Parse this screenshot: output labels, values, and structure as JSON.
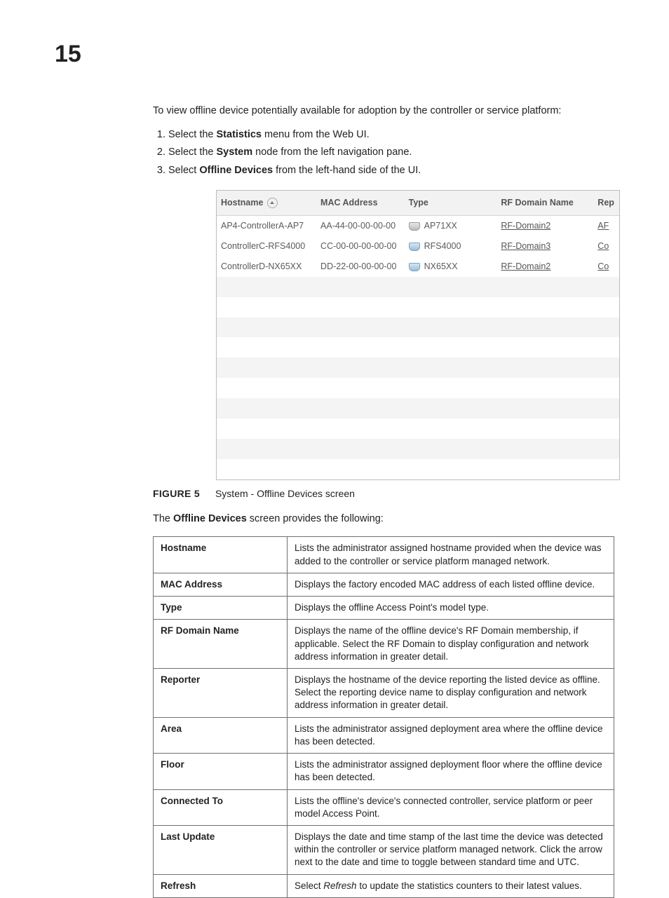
{
  "chapter_number": "15",
  "intro": "To view offline device potentially available for adoption by the controller or service platform:",
  "steps": [
    {
      "pre": "Select the ",
      "bold": "Statistics",
      "post": " menu from the Web UI."
    },
    {
      "pre": "Select the ",
      "bold": "System",
      "post": " node from the left navigation pane."
    },
    {
      "pre": "Select ",
      "bold": "Offline Devices",
      "post": " from the left-hand side of the UI."
    }
  ],
  "screenshot": {
    "columns": {
      "hostname": "Hostname",
      "mac": "MAC Address",
      "type": "Type",
      "rf": "RF Domain Name",
      "rep": "Rep"
    },
    "rows": [
      {
        "hostname": "AP4-ControllerA-AP7",
        "mac": "AA-44-00-00-00-00",
        "icon": "ap",
        "type": "AP71XX",
        "rf": "RF-Domain2",
        "rep": "AF"
      },
      {
        "hostname": "ControllerC-RFS4000",
        "mac": "CC-00-00-00-00-00",
        "icon": "ct",
        "type": "RFS4000",
        "rf": "RF-Domain3",
        "rep": "Co"
      },
      {
        "hostname": "ControllerD-NX65XX",
        "mac": "DD-22-00-00-00-00",
        "icon": "ct",
        "type": "NX65XX",
        "rf": "RF-Domain2",
        "rep": "Co"
      }
    ],
    "empty_rows": 10
  },
  "figure": {
    "label": "FIGURE 5",
    "caption": "System - Offline Devices screen"
  },
  "after_fig": {
    "pre": "The ",
    "bold": "Offline Devices",
    "post": " screen provides the following:"
  },
  "desc": [
    {
      "k": "Hostname",
      "v": "Lists the administrator assigned hostname provided when the device was added to the controller or service platform managed network."
    },
    {
      "k": "MAC Address",
      "v": "Displays the factory encoded MAC address of each listed offline device."
    },
    {
      "k": "Type",
      "v": "Displays the offline Access Point's model type."
    },
    {
      "k": "RF Domain Name",
      "v": "Displays the name of the offline device's RF Domain membership, if applicable. Select the RF Domain to display configuration and network address information in greater detail."
    },
    {
      "k": "Reporter",
      "v": "Displays the hostname of the device reporting the listed device as offline. Select the reporting device name to display configuration and network address information in greater detail."
    },
    {
      "k": "Area",
      "v": "Lists the administrator assigned deployment area where the offline device has been detected."
    },
    {
      "k": "Floor",
      "v": "Lists the administrator assigned deployment floor where the offline device has been detected."
    },
    {
      "k": "Connected To",
      "v": "Lists the offline's device's connected controller, service platform or peer model Access Point."
    },
    {
      "k": "Last Update",
      "v": "Displays the date and time stamp of the last time the device was detected within the controller or service platform managed network. Click the arrow next to the date and time to toggle between standard time and UTC."
    },
    {
      "k": "Refresh",
      "v_pre": "Select ",
      "v_it": "Refresh",
      "v_post": " to update the statistics counters to their latest values."
    }
  ]
}
